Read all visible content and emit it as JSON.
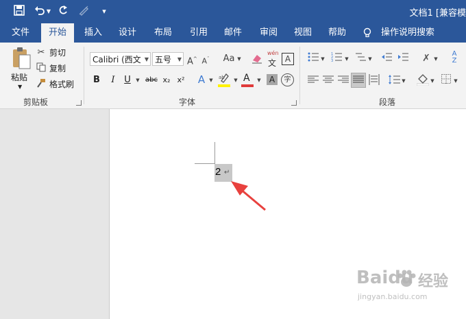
{
  "title_bar": {
    "doc_title": "文档1 [兼容模",
    "bg_color": "#2b579a"
  },
  "ribbon_tabs": [
    "文件",
    "开始",
    "插入",
    "设计",
    "布局",
    "引用",
    "邮件",
    "审阅",
    "视图",
    "帮助"
  ],
  "tell_me": "操作说明搜索",
  "clipboard": {
    "paste": "粘贴",
    "cut": "剪切",
    "copy": "复制",
    "format_painter": "格式刷",
    "group_label": "剪贴板"
  },
  "font": {
    "font_name": "Calibri (西文​",
    "font_size": "五号",
    "change_case": "Aa",
    "bold": "B",
    "italic": "I",
    "underline": "U",
    "strikethrough": "abc",
    "subscript": "x₂",
    "superscript": "x²",
    "phonetic_top": "wén",
    "phonetic_bottom": "文",
    "char_border": "A",
    "font_color_letter": "A",
    "text_effect": "A",
    "char_shading": "A",
    "enclose": "字",
    "group_label": "字体",
    "font_color": "#e03a3a",
    "highlight_color": "#fff200"
  },
  "paragraph": {
    "group_label": "段落"
  },
  "document": {
    "selected_text": "2",
    "para_mark": "↵",
    "arrow_color": "#e8413e"
  },
  "watermark": {
    "brand": "Baidu",
    "brand_cn": "经验",
    "url": "jingyan.baidu.com"
  }
}
